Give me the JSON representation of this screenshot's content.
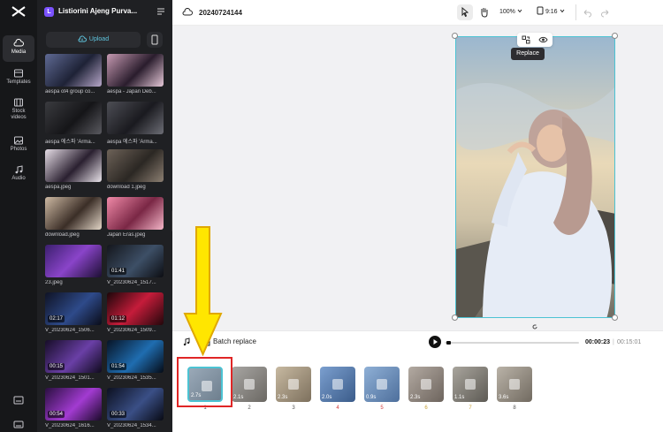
{
  "app": {
    "project_badge": "L",
    "project_name": "Listiorini Ajeng Purva...",
    "brand_logo": "capcut-logo-icon"
  },
  "rail": {
    "items": [
      {
        "label": "Media",
        "icon": "media-icon"
      },
      {
        "label": "Templates",
        "icon": "templates-icon"
      },
      {
        "label": "Stock videos",
        "icon": "stock-videos-icon"
      },
      {
        "label": "Photos",
        "icon": "photos-icon"
      },
      {
        "label": "Audio",
        "icon": "audio-icon"
      }
    ]
  },
  "media_panel": {
    "upload_label": "Upload",
    "items": [
      {
        "name": "aespa ot4 group co...",
        "duration": ""
      },
      {
        "name": "aespa - Japan Deb...",
        "duration": ""
      },
      {
        "name": "aespa 에스파 'Arma...",
        "duration": ""
      },
      {
        "name": "aespa 에스파 'Arma...",
        "duration": ""
      },
      {
        "name": "aespa.jpeg",
        "duration": ""
      },
      {
        "name": "download 1.jpeg",
        "duration": ""
      },
      {
        "name": "download.jpeg",
        "duration": ""
      },
      {
        "name": "Japan Eras.jpeg",
        "duration": ""
      },
      {
        "name": "23.jpeg",
        "duration": ""
      },
      {
        "name": "V_20230624_1517...",
        "duration": "01:41"
      },
      {
        "name": "V_20230624_1506...",
        "duration": "02:17"
      },
      {
        "name": "V_20230624_1509...",
        "duration": "01:12"
      },
      {
        "name": "V_20230624_1501...",
        "duration": "00:15"
      },
      {
        "name": "V_20230624_1535...",
        "duration": "01:54"
      },
      {
        "name": "V_20230624_1616...",
        "duration": "00:54"
      },
      {
        "name": "V_20230624_1534...",
        "duration": "00:33"
      }
    ]
  },
  "toolbar": {
    "title": "20240724144",
    "zoom": "100%",
    "ratio": "9:16"
  },
  "canvas": {
    "tooltip": "Replace"
  },
  "timeline": {
    "batch_replace": "Batch replace",
    "current_time": "00:00:23",
    "separator": "|",
    "total_time": "00:15:01",
    "clips": [
      {
        "duration": "2.7s",
        "number": "1"
      },
      {
        "duration": "2.1s",
        "number": "2"
      },
      {
        "duration": "2.3s",
        "number": "3"
      },
      {
        "duration": "2.0s",
        "number": "4"
      },
      {
        "duration": "0.9s",
        "number": "5"
      },
      {
        "duration": "2.3s",
        "number": "6"
      },
      {
        "duration": "1.1s",
        "number": "7"
      },
      {
        "duration": "3.6s",
        "number": "8"
      }
    ]
  },
  "colors": {
    "accent": "#4cc3d3",
    "highlight_box": "#e02626",
    "arrow": "#ffe600"
  }
}
